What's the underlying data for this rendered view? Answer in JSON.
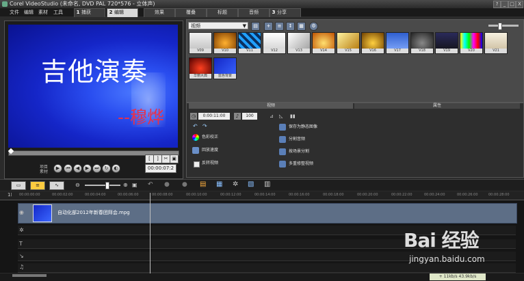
{
  "window": {
    "title": "Corel VideoStudio (未命名, DVD PAL 720*576 - 立体声)",
    "controls": [
      "?",
      "_",
      "□",
      "X"
    ]
  },
  "menu": {
    "items": [
      "文件",
      "编辑",
      "素材",
      "工具"
    ]
  },
  "steps": [
    {
      "num": "1",
      "label": "捕获"
    },
    {
      "num": "2",
      "label": "编辑"
    },
    {
      "num": "",
      "label": "效果"
    },
    {
      "num": "",
      "label": "覆叠"
    },
    {
      "num": "",
      "label": "标题"
    },
    {
      "num": "",
      "label": "音频"
    },
    {
      "num": "3",
      "label": "分享"
    }
  ],
  "preview": {
    "title_text": "吉他演奏",
    "credit_text": "--穆烨",
    "timecode": "00:00:07:2",
    "bracket_in": "[",
    "bracket_out": "]",
    "project_label": "项目",
    "clip_label": "素材"
  },
  "library": {
    "category": "视频",
    "thumbs": [
      "V09",
      "V10",
      "V11",
      "V12",
      "V13",
      "V14",
      "V15",
      "V16",
      "V17",
      "V18",
      "V19",
      "V20",
      "V21"
    ],
    "thumbs_row2": [
      "华丽大典",
      "蓝色背景"
    ]
  },
  "options": {
    "tab_video": "视频",
    "tab_attr": "属性",
    "duration": "0:00:11:00",
    "volume": "100",
    "items_left": [
      "色彩校正",
      "回放速度",
      "反转视频"
    ],
    "items_right": [
      "保存为静态图像",
      "分割音频",
      "按场景分割",
      "多重修整视频"
    ]
  },
  "timeline": {
    "ruler_labels": [
      "00:00:00:00",
      "00:00:02:00",
      "00:00:04:00",
      "00:00:06:00",
      "00:00:08:00",
      "00:00:10:00",
      "00:00:12:00",
      "00:00:14:00",
      "00:00:16:00",
      "00:00:18:00",
      "00:00:20:00",
      "00:00:22:00",
      "00:00:24:00",
      "00:00:26:00",
      "00:00:28:00"
    ],
    "clip_name": "自动化部2012年新春团拜会.mpg"
  },
  "status": {
    "text": "+ 11kb/s   43.9kb/s"
  },
  "watermark": {
    "logo": "Bai 经验",
    "url": "jingyan.baidu.com"
  },
  "colors": {
    "preview_bg": "#1526c8",
    "credit": "#e8304a",
    "track": "#5d6e86"
  }
}
